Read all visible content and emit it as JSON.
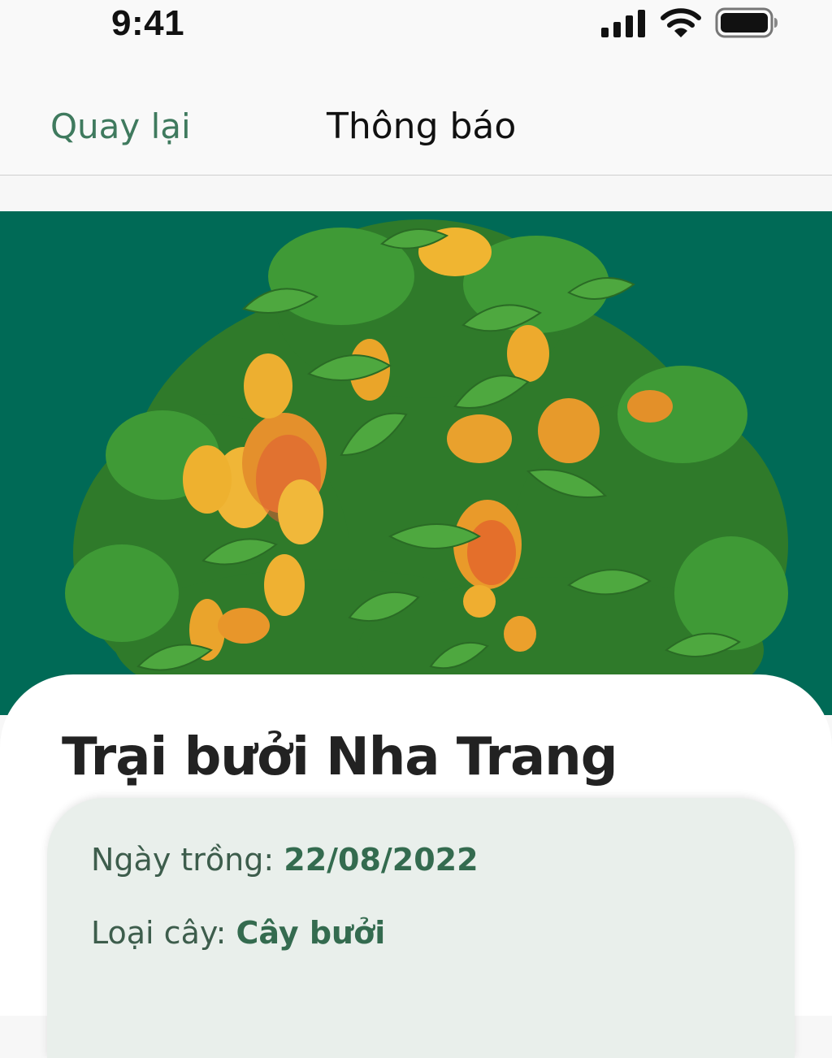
{
  "status_bar": {
    "time": "9:41",
    "icons": [
      "signal-icon",
      "wifi-icon",
      "battery-icon"
    ]
  },
  "nav": {
    "back_label": "Quay lại",
    "title": "Thông báo"
  },
  "hero": {
    "image": "mango-tree-image",
    "background_color": "#006a56"
  },
  "farm": {
    "title": "Trại bưởi Nha Trang",
    "details": {
      "planting_date_label": "Ngày trồng: ",
      "planting_date_value": "22/08/2022",
      "tree_type_label": "Loại cây: ",
      "tree_type_value": "Cây bưởi"
    }
  },
  "colors": {
    "accent": "#3f7a5e",
    "info_box_bg": "#e9efeb",
    "value_text": "#346b4f"
  }
}
